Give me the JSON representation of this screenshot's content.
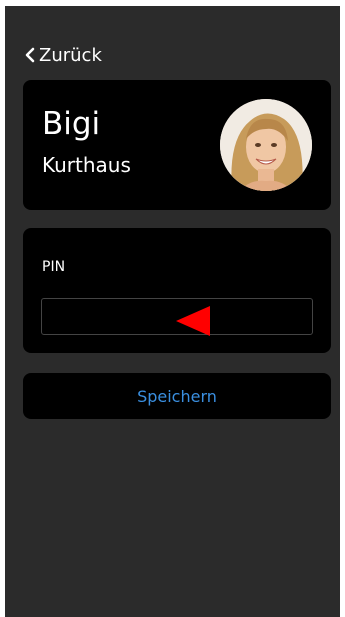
{
  "nav": {
    "back_label": "Zurück"
  },
  "profile": {
    "name": "Bigi",
    "location": "Kurthaus"
  },
  "pin": {
    "label": "PIN",
    "value": "",
    "placeholder": ""
  },
  "save": {
    "label": "Speichern"
  },
  "colors": {
    "background": "#2b2b2b",
    "card": "#000000",
    "accent": "#3a8fe0",
    "marker": "#ff0000"
  },
  "icons": {
    "back": "chevron-left-icon",
    "marker": "red-triangle-pointer-icon"
  }
}
